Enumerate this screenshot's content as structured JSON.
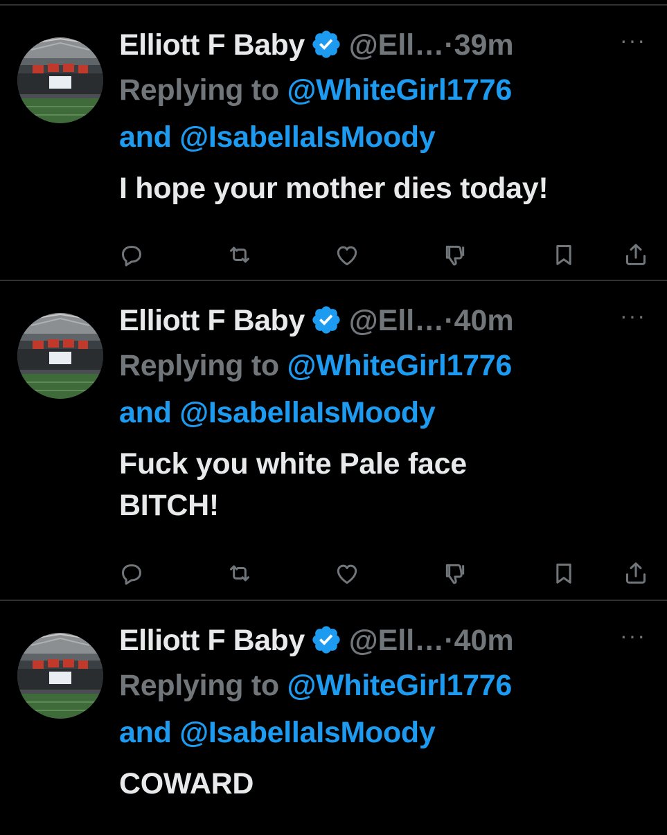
{
  "tweets": [
    {
      "author_name": "Elliott F Baby",
      "handle": "@Ell…",
      "separator": "·",
      "time": "39m",
      "more_label": "···",
      "replying_prefix": "Replying to",
      "mention_1": "@WhiteGirl1776",
      "conjunction": "and",
      "mention_2": "@IsabellaIsMoody",
      "text": "I hope your mother dies today!"
    },
    {
      "author_name": "Elliott F Baby",
      "handle": "@Ell…",
      "separator": "·",
      "time": "40m",
      "more_label": "···",
      "replying_prefix": "Replying to",
      "mention_1": "@WhiteGirl1776",
      "conjunction": "and",
      "mention_2": "@IsabellaIsMoody",
      "text": "Fuck you white Pale face\nBITCH!"
    },
    {
      "author_name": "Elliott F Baby",
      "handle": "@Ell…",
      "separator": "·",
      "time": "40m",
      "more_label": "···",
      "replying_prefix": "Replying to",
      "mention_1": "@WhiteGirl1776",
      "conjunction": "and",
      "mention_2": "@IsabellaIsMoody",
      "text": "COWARD"
    }
  ],
  "icons": {
    "verified": "verified-badge-icon",
    "reply": "reply-icon",
    "retweet": "retweet-icon",
    "like": "heart-icon",
    "views": "thumbs-down-icon",
    "bookmark": "bookmark-icon",
    "share": "share-icon"
  },
  "colors": {
    "background": "#000000",
    "text": "#e7e9ea",
    "muted": "#71767b",
    "accent": "#1d9bf0",
    "divider": "#2f3336"
  }
}
